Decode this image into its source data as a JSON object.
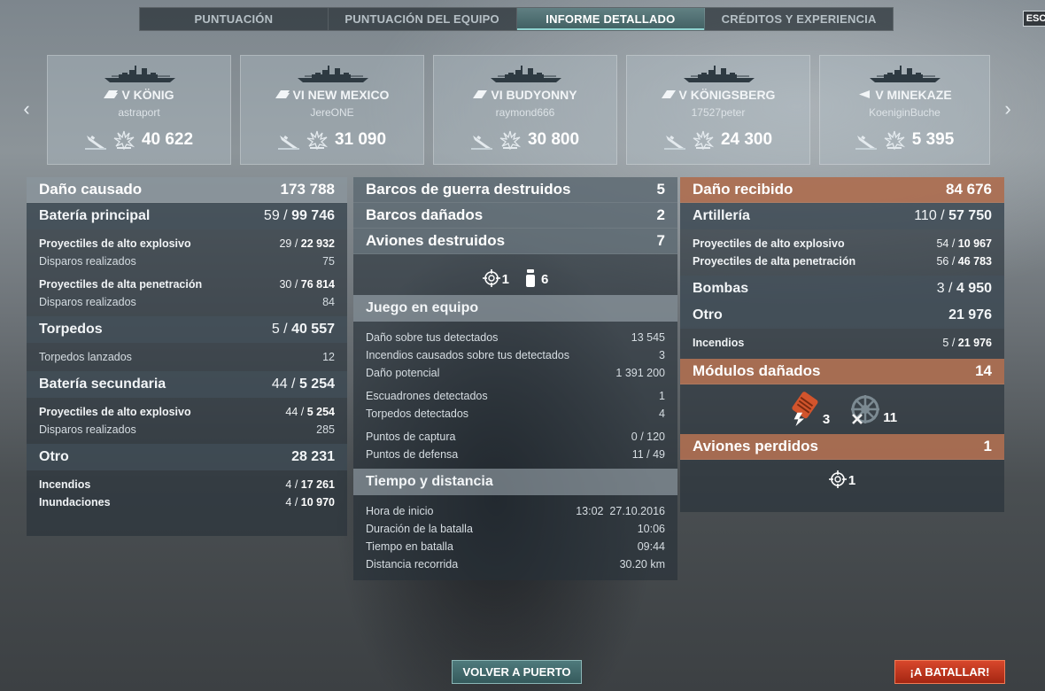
{
  "tabs": [
    {
      "label": "PUNTUACIÓN",
      "active": false
    },
    {
      "label": "PUNTUACIÓN DEL EQUIPO",
      "active": false
    },
    {
      "label": "INFORME DETALLADO",
      "active": true
    },
    {
      "label": "CRÉDITOS Y EXPERIENCIA",
      "active": false
    }
  ],
  "esc_label": "ESC",
  "nav": {
    "prev_icon": "chevron-left-icon",
    "next_icon": "chevron-right-icon"
  },
  "ships": [
    {
      "name": "V KÖNIG",
      "player": "astraport",
      "damage": "40 622",
      "class_icon": "battleship-class-icon"
    },
    {
      "name": "VI NEW MEXICO",
      "player": "JereONE",
      "damage": "31 090",
      "class_icon": "battleship-class-icon"
    },
    {
      "name": "VI BUDYONNY",
      "player": "raymond666",
      "damage": "30 800",
      "class_icon": "cruiser-class-icon"
    },
    {
      "name": "V KÖNIGSBERG",
      "player": "17527peter",
      "damage": "24 300",
      "class_icon": "cruiser-class-icon"
    },
    {
      "name": "V MINEKAZE",
      "player": "KoeniginBuche",
      "damage": "5 395",
      "class_icon": "destroyer-class-icon"
    }
  ],
  "left": {
    "header": {
      "label": "Daño causado",
      "value": "173 788"
    },
    "main_battery": {
      "label": "Batería principal",
      "hits": "59",
      "damage": "99 746"
    },
    "main_rows": [
      {
        "label": "Proyectiles de alto explosivo",
        "hits": "29",
        "damage": "22 932",
        "bold": true
      },
      {
        "label": "Disparos realizados",
        "value": "75",
        "bold": false
      },
      {
        "label": "Proyectiles de alta penetración",
        "hits": "30",
        "damage": "76 814",
        "bold": true
      },
      {
        "label": "Disparos realizados",
        "value": "84",
        "bold": false
      }
    ],
    "torpedoes": {
      "label": "Torpedos",
      "hits": "5",
      "damage": "40 557"
    },
    "torpedo_rows": [
      {
        "label": "Torpedos lanzados",
        "value": "12"
      }
    ],
    "secondary": {
      "label": "Batería secundaria",
      "hits": "44",
      "damage": "5 254"
    },
    "secondary_rows": [
      {
        "label": "Proyectiles de alto explosivo",
        "hits": "44",
        "damage": "5 254",
        "bold": true
      },
      {
        "label": "Disparos realizados",
        "value": "285",
        "bold": false
      }
    ],
    "other": {
      "label": "Otro",
      "value": "28 231"
    },
    "other_rows": [
      {
        "label": "Incendios",
        "hits": "4",
        "damage": "17 261"
      },
      {
        "label": "Inundaciones",
        "hits": "4",
        "damage": "10 970"
      }
    ]
  },
  "middle": {
    "warships_destroyed": {
      "label": "Barcos de guerra destruidos",
      "value": "5"
    },
    "ships_damaged": {
      "label": "Barcos dañados",
      "value": "2"
    },
    "planes_destroyed": {
      "label": "Aviones destruidos",
      "value": "7"
    },
    "plane_icons": [
      {
        "icon": "crosshair-icon",
        "value": "1"
      },
      {
        "icon": "fighter-icon",
        "value": "6"
      }
    ],
    "teamplay": {
      "label": "Juego en equipo"
    },
    "teamplay_rows": [
      {
        "label": "Daño sobre tus detectados",
        "value": "13 545"
      },
      {
        "label": "Incendios causados sobre tus detectados",
        "value": "3"
      },
      {
        "label": "Daño potencial",
        "value": "1 391 200"
      },
      {
        "label": "Escuadrones detectados",
        "value": "1"
      },
      {
        "label": "Torpedos detectados",
        "value": "4"
      },
      {
        "label": "Puntos de captura",
        "value": "0 / 120"
      },
      {
        "label": "Puntos de defensa",
        "value": "11 / 49"
      }
    ],
    "time": {
      "label": "Tiempo y distancia"
    },
    "time_rows": [
      {
        "label": "Hora de inicio",
        "value": "13:02  27.10.2016"
      },
      {
        "label": "Duración de la batalla",
        "value": "10:06"
      },
      {
        "label": "Tiempo en batalla",
        "value": "09:44"
      },
      {
        "label": "Distancia recorrida",
        "value": "30.20 km"
      }
    ]
  },
  "right": {
    "header": {
      "label": "Daño recibido",
      "value": "84 676"
    },
    "artillery": {
      "label": "Artillería",
      "hits": "110",
      "damage": "57 750"
    },
    "artillery_rows": [
      {
        "label": "Proyectiles de alto explosivo",
        "hits": "54",
        "damage": "10 967"
      },
      {
        "label": "Proyectiles de alta penetración",
        "hits": "56",
        "damage": "46 783"
      }
    ],
    "bombs": {
      "label": "Bombas",
      "hits": "3",
      "damage": "4 950"
    },
    "other": {
      "label": "Otro",
      "value": "21 976"
    },
    "other_rows": [
      {
        "label": "Incendios",
        "hits": "5",
        "damage": "21 976"
      }
    ],
    "modules": {
      "label": "Módulos dañados",
      "value": "14"
    },
    "module_icons": [
      {
        "icon": "engine-damage-icon",
        "value": "3"
      },
      {
        "icon": "steering-gear-damage-icon",
        "value": "11"
      }
    ],
    "planes_lost": {
      "label": "Aviones perdidos",
      "value": "1"
    },
    "planes_lost_icons": [
      {
        "icon": "crosshair-icon",
        "value": "1"
      }
    ]
  },
  "buttons": {
    "port": "VOLVER A PUERTO",
    "battle": "¡A BATALLAR!"
  },
  "colors": {
    "accent_tab": "#8fd3d0",
    "received_header": "#c47854",
    "battle_button": "#c8341c",
    "port_button": "#426a6c"
  }
}
